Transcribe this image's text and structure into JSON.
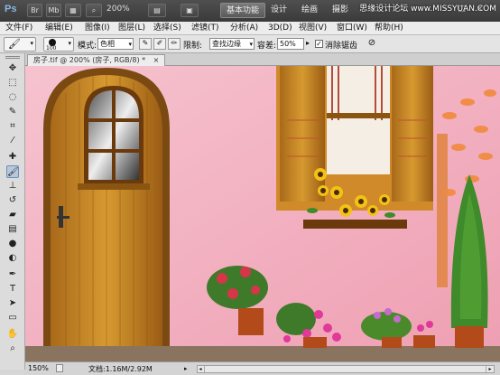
{
  "app": {
    "logo": "Ps",
    "buttons": [
      "Br",
      "Mb"
    ],
    "zoom": "200%",
    "workspaces": [
      "基本功能",
      "设计",
      "绘画",
      "摄影"
    ],
    "window_controls": [
      "–",
      "□",
      "×"
    ],
    "watermark": "思缘设计论坛 www.MISSYUAN.COM"
  },
  "menu": {
    "items": [
      "文件(F)",
      "编辑(E)",
      "图像(I)",
      "图层(L)",
      "选择(S)",
      "滤镜(T)",
      "分析(A)",
      "3D(D)",
      "视图(V)",
      "窗口(W)",
      "帮助(H)"
    ]
  },
  "options": {
    "brush_size": "100",
    "mode_label": "模式:",
    "mode_value": "色相",
    "limits_label": "限制:",
    "limits_value": "查找边缘",
    "tolerance_label": "容差:",
    "tolerance_value": "50%",
    "antialias_label": "消除锯齿",
    "antialias_checked": true
  },
  "document": {
    "tab_title": "房子.tif @ 200% (房子, RGB/8) *",
    "tab_close": "×"
  },
  "status": {
    "zoom": "150%",
    "doc_info": "文档:1.16M/2.92M"
  },
  "colors": {
    "wall": "#f2b3c0",
    "door": "#c98a22",
    "accent_active": "#6b8fb8"
  },
  "tools": [
    "move-icon",
    "marquee-icon",
    "lasso-icon",
    "quick-select-icon",
    "crop-icon",
    "eyedropper-icon",
    "healing-icon",
    "brush-icon",
    "color-replace-icon",
    "stamp-icon",
    "history-brush-icon",
    "eraser-icon",
    "gradient-icon",
    "blur-icon",
    "dodge-icon",
    "pen-icon",
    "type-icon",
    "path-select-icon",
    "shape-icon",
    "hand-icon",
    "zoom-icon"
  ]
}
